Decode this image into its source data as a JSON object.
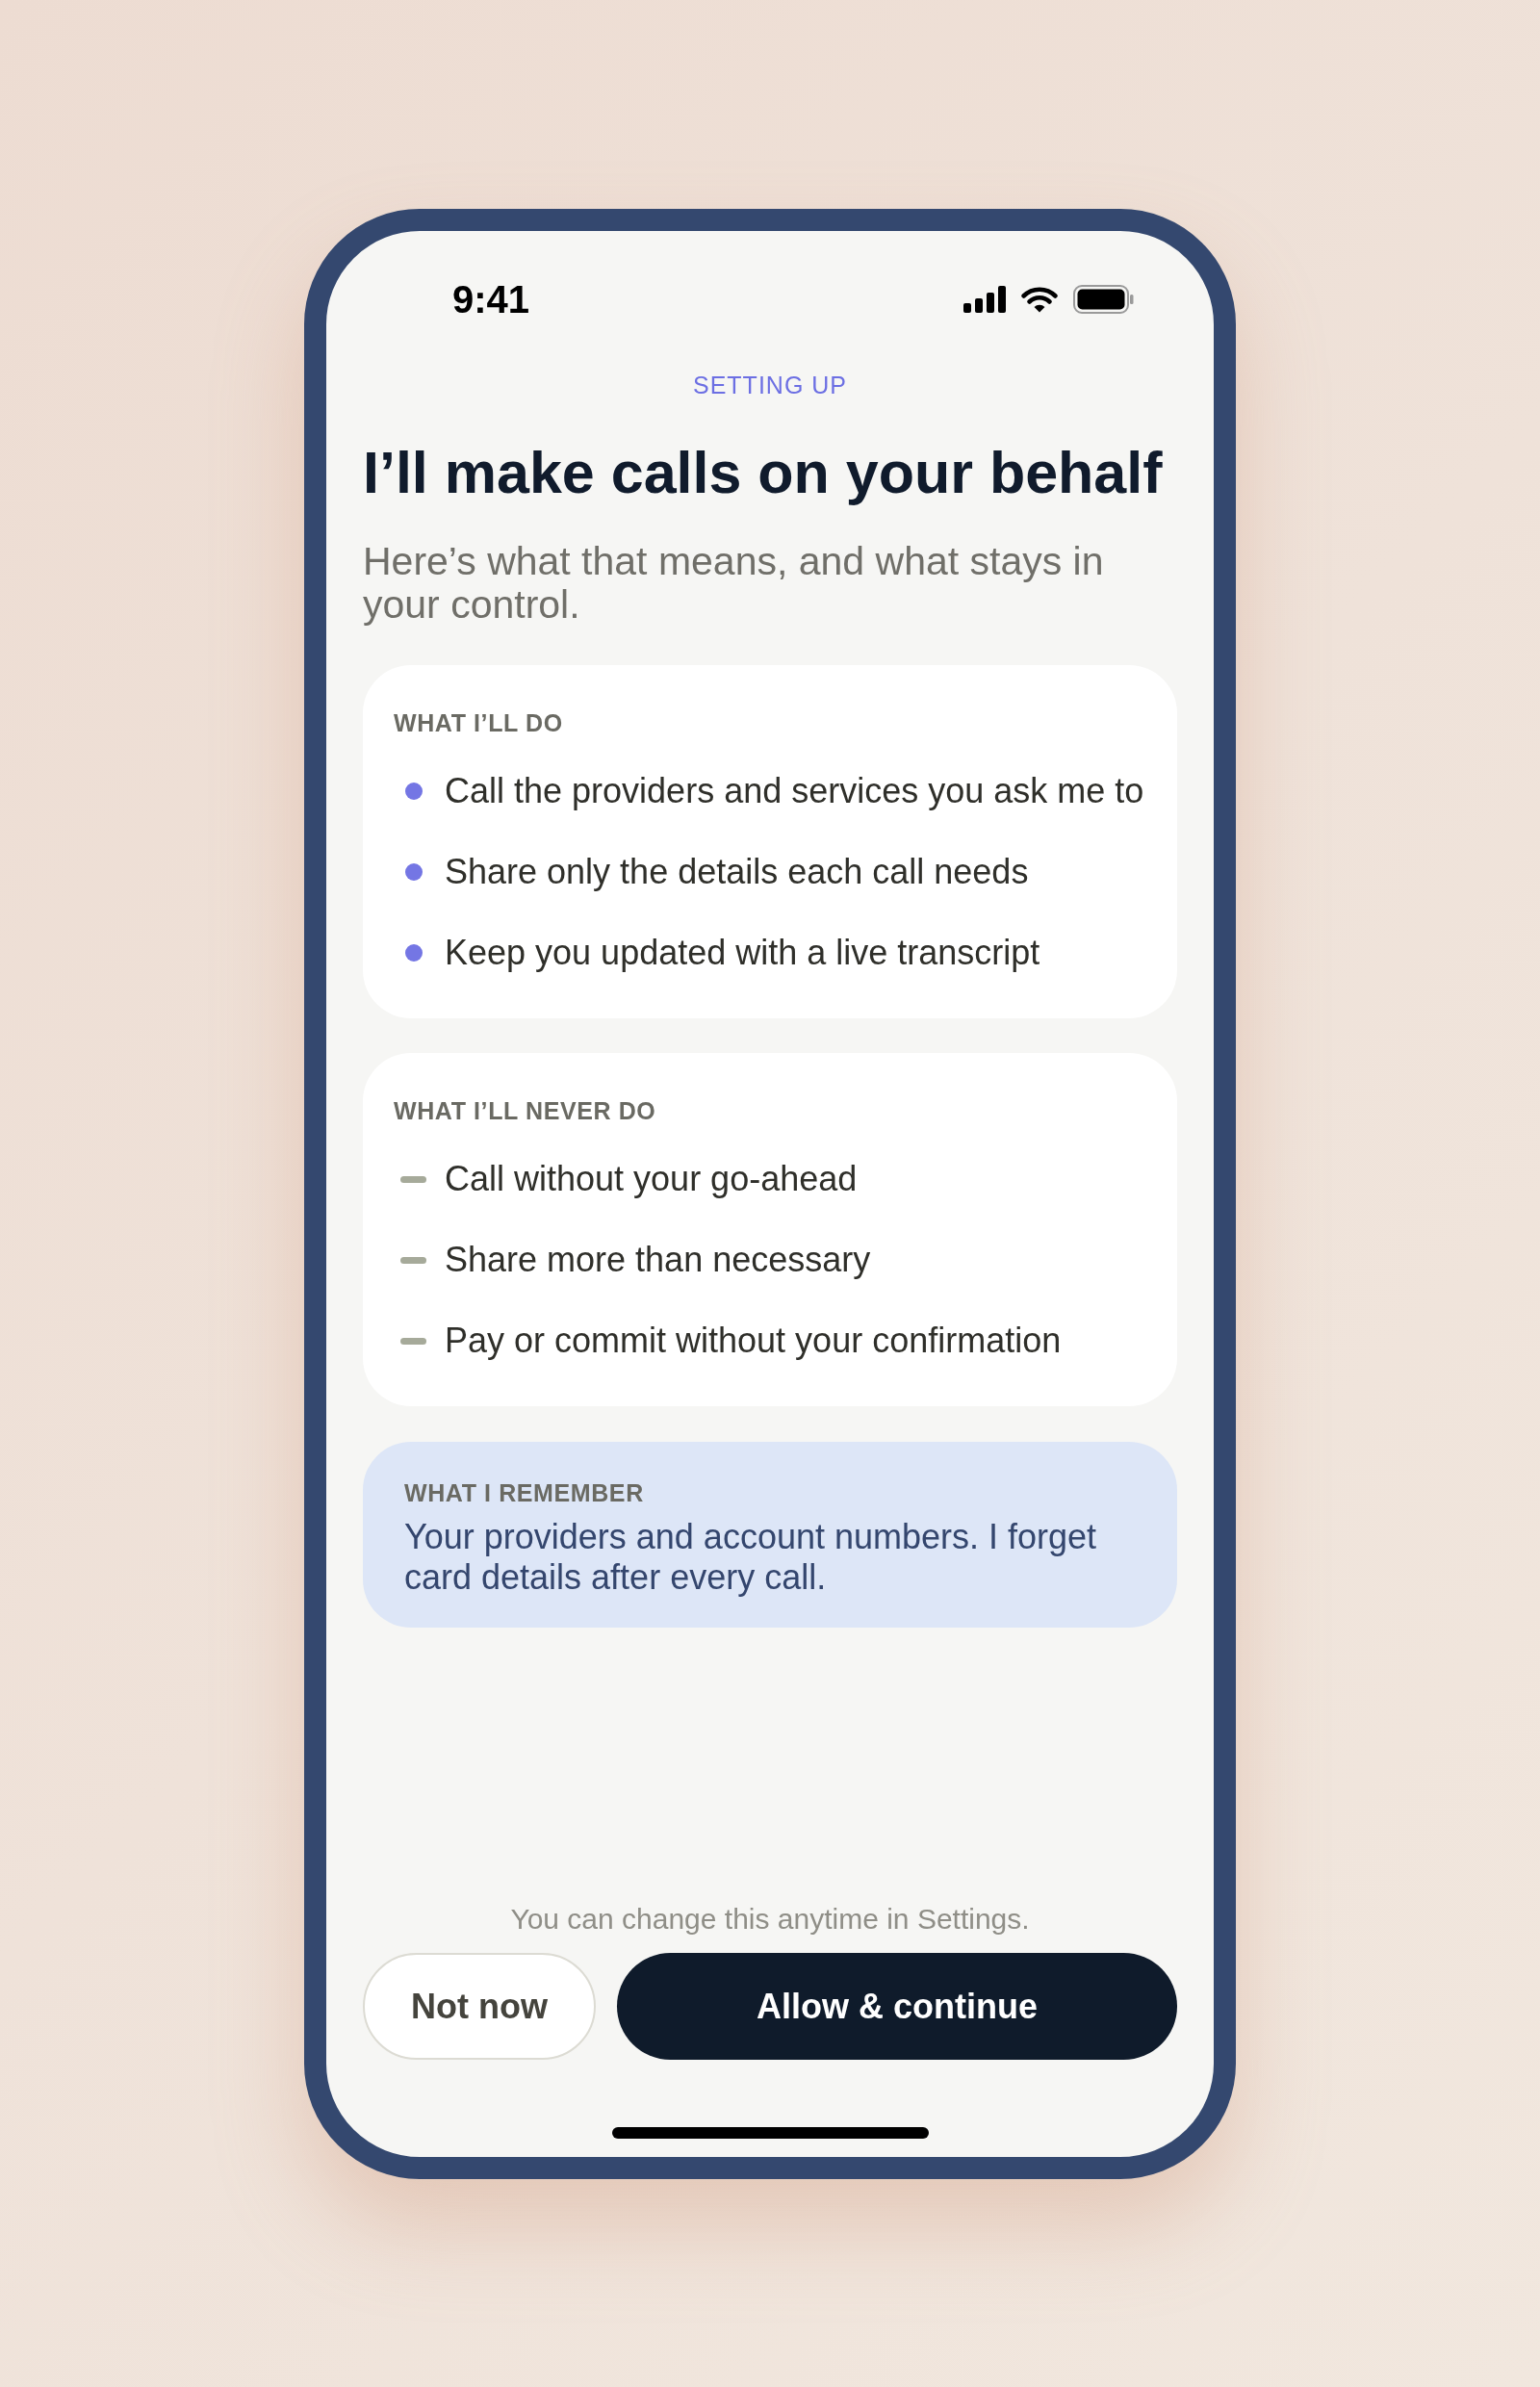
{
  "status_bar": {
    "time": "9:41"
  },
  "eyebrow": "SETTING UP",
  "title": "I’ll make calls on your behalf",
  "subtitle": "Here’s what that means, and what stays in your control.",
  "sections": [
    {
      "kind": "bullets",
      "heading": "WHAT I’LL DO",
      "items": [
        "Call the providers and services you ask me to",
        "Share only the details each call needs",
        "Keep you updated with a live transcript"
      ]
    },
    {
      "kind": "dashes",
      "heading": "WHAT I’LL NEVER DO",
      "items": [
        "Call without your go-ahead",
        "Share more than necessary",
        "Pay or commit without your confirmation"
      ]
    },
    {
      "kind": "note",
      "heading": "WHAT I REMEMBER",
      "text": "Your providers and account numbers. I forget card details after every call."
    }
  ],
  "footnote": "You can change this anytime in Settings.",
  "buttons": [
    {
      "kind": "secondary",
      "label": "Not now"
    },
    {
      "kind": "primary",
      "label": "Allow & continue"
    }
  ]
}
